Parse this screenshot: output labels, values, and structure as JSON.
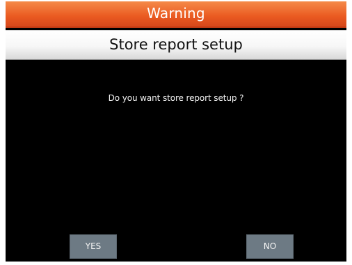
{
  "warning_bar": {
    "title": "Warning"
  },
  "setup_bar": {
    "title": "Store report setup"
  },
  "dialog": {
    "message": "Do you want store report setup ?"
  },
  "buttons": {
    "yes_label": "YES",
    "no_label": "NO"
  },
  "colors": {
    "warning_orange": "#ea5a21",
    "background": "#000000",
    "button_gray": "#6d7a84",
    "header_light": "#f7f7f7"
  }
}
